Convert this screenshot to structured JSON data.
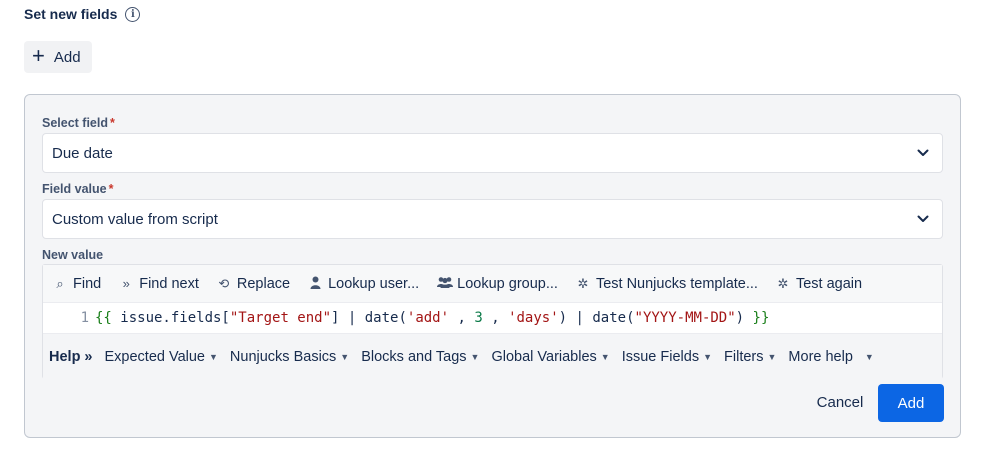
{
  "section": {
    "title": "Set new fields",
    "info_icon": "info-icon"
  },
  "top_add": {
    "icon": "plus-icon",
    "label": "Add"
  },
  "select_field": {
    "label": "Select field",
    "required": "*",
    "value": "Due date"
  },
  "field_value": {
    "label": "Field value",
    "required": "*",
    "value": "Custom value from script"
  },
  "new_value": {
    "label": "New value"
  },
  "toolbar": [
    {
      "icon": "search-icon",
      "glyph": "⌕",
      "label": "Find"
    },
    {
      "icon": "find-next-icon",
      "glyph": "»",
      "label": "Find next"
    },
    {
      "icon": "replace-icon",
      "glyph": "⟲",
      "label": "Replace"
    },
    {
      "icon": "user-icon",
      "glyph": "●",
      "label": "Lookup user..."
    },
    {
      "icon": "group-icon",
      "glyph": "●●",
      "label": "Lookup group..."
    },
    {
      "icon": "bug-icon",
      "glyph": "✲",
      "label": "Test Nunjucks template..."
    },
    {
      "icon": "bug-icon",
      "glyph": "✲",
      "label": "Test again"
    }
  ],
  "code": {
    "line_number": "1",
    "open_brace": "{{",
    "expr_a": " issue.fields[",
    "str_field": "\"Target end\"",
    "expr_b": "] | date(",
    "str_add": "'add'",
    "expr_c": " , ",
    "num": "3",
    "expr_d": " , ",
    "str_days": "'days'",
    "expr_e": ") | date(",
    "str_fmt": "\"YYYY-MM-DD\"",
    "expr_f": ") ",
    "close_brace": "}}"
  },
  "help": {
    "label": "Help",
    "arrow": "»",
    "items": [
      "Expected Value",
      "Nunjucks Basics",
      "Blocks and Tags",
      "Global Variables",
      "Issue Fields",
      "Filters",
      "More help"
    ]
  },
  "actions": {
    "cancel": "Cancel",
    "add": "Add"
  },
  "colors": {
    "primary": "#0c66e4",
    "required": "#c9372c",
    "string": "#a31515",
    "number": "#0b7a48",
    "brace": "#1a7f1a"
  }
}
